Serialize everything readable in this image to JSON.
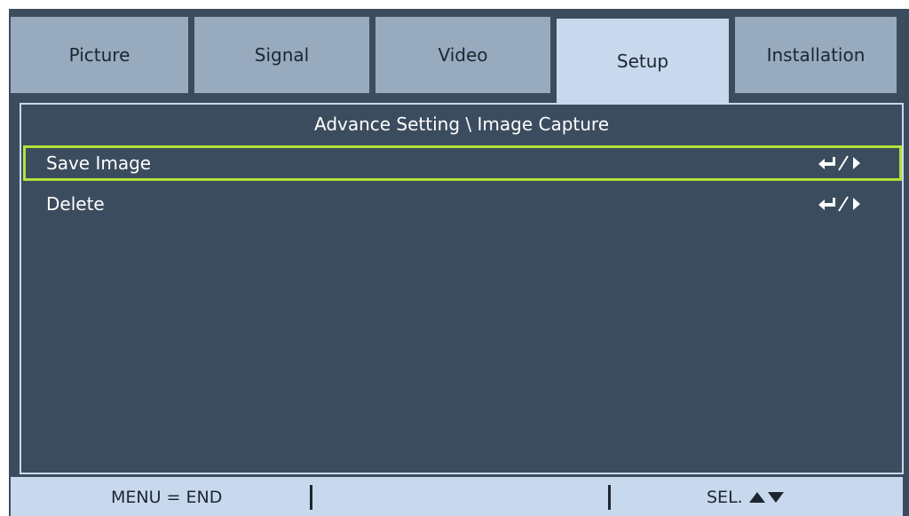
{
  "tabs": [
    {
      "label": "Picture"
    },
    {
      "label": "Signal"
    },
    {
      "label": "Video"
    },
    {
      "label": "Setup"
    },
    {
      "label": "Installation"
    }
  ],
  "active_tab": "Setup",
  "breadcrumb": "Advance Setting \\ Image Capture",
  "items": [
    {
      "label": "Save Image",
      "action_icon": "enter-right-icon",
      "selected": true
    },
    {
      "label": "Delete",
      "action_icon": "enter-right-icon",
      "selected": false
    }
  ],
  "footer": {
    "menu_hint": "MENU = END",
    "select_hint": "SEL."
  },
  "colors": {
    "background": "#3b4c5e",
    "tab_inactive": "#98aabe",
    "tab_active": "#c8d9ee",
    "selection_border": "#b3e03a",
    "text_light": "#ffffff",
    "text_dark": "#1d2630"
  }
}
